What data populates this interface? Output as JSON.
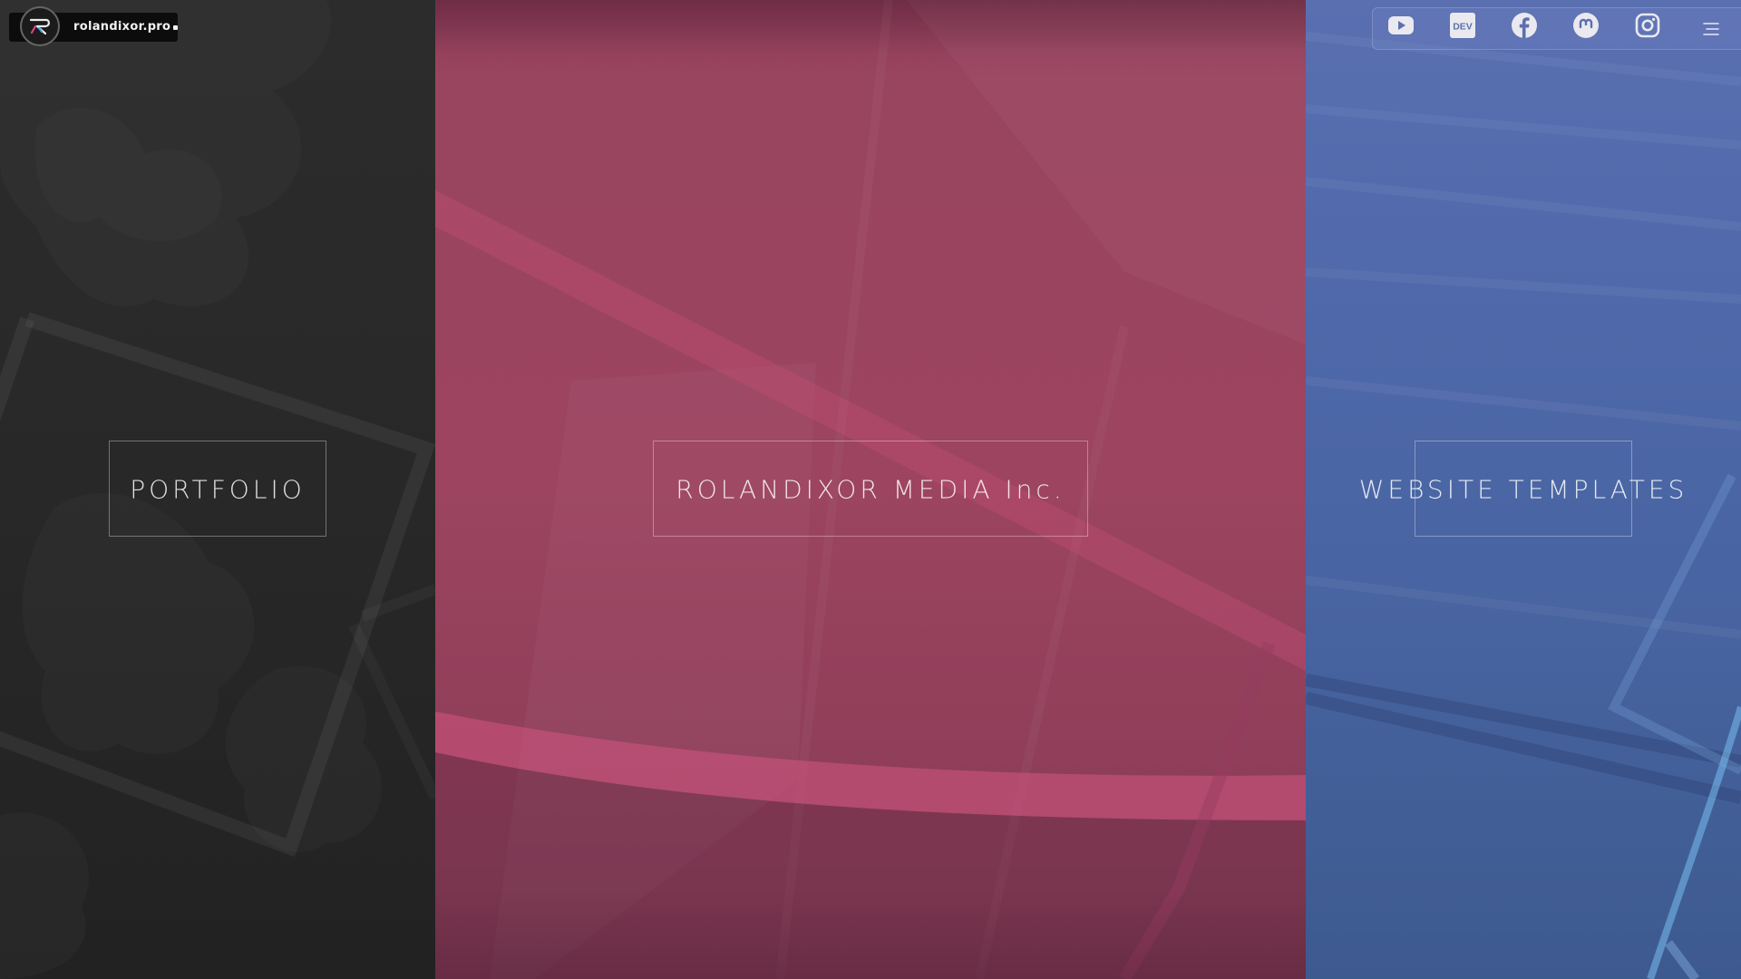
{
  "brand": {
    "name": "rolandixor.pro"
  },
  "panels": [
    {
      "label": "PORTFOLIO",
      "color": "#2a2a2a"
    },
    {
      "label": "ROLANDIXOR MEDIA Inc.",
      "color": "#9b4460"
    },
    {
      "label": "WEBSITE TEMPLATES",
      "color": "#4d68a8"
    }
  ],
  "social": {
    "icons": [
      "youtube-icon",
      "dev-icon",
      "facebook-icon",
      "mastodon-icon",
      "instagram-icon",
      "menu-icon"
    ],
    "dev_text": "DEV"
  }
}
